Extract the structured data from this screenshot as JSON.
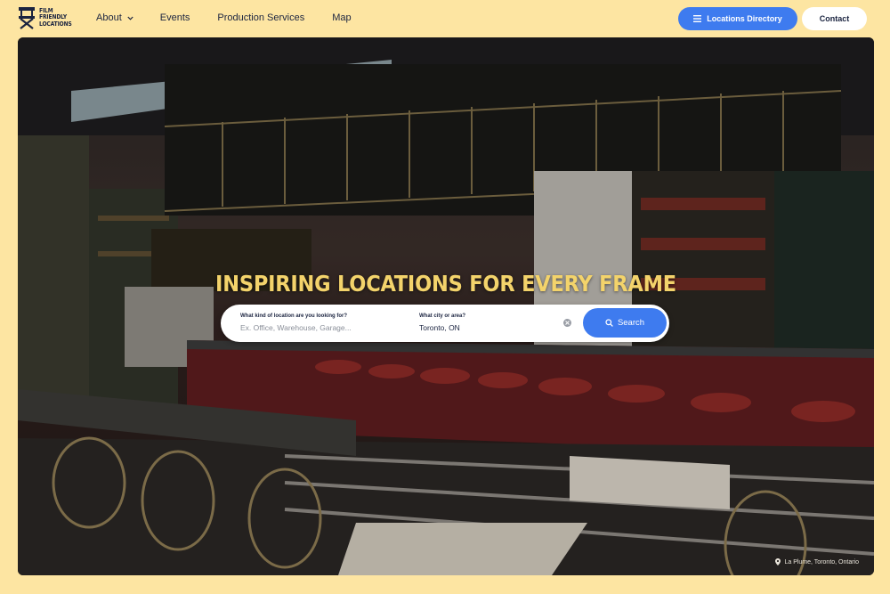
{
  "brand": {
    "logo_lines": [
      "FILM",
      "FRIENDLY",
      "LOCATIONS"
    ],
    "icon": "directors-chair-icon"
  },
  "nav": {
    "items": [
      {
        "label": "About",
        "has_dropdown": true
      },
      {
        "label": "Events"
      },
      {
        "label": "Production Services"
      },
      {
        "label": "Map"
      }
    ],
    "directory_button": {
      "label": "Locations Directory",
      "icon": "menu-icon"
    },
    "contact_button": {
      "label": "Contact"
    }
  },
  "hero": {
    "headline": "INSPIRING LOCATIONS FOR EVERY FRAME",
    "search": {
      "what_label": "What kind of location are you looking for?",
      "what_placeholder": "Ex. Office, Warehouse, Garage...",
      "where_label": "What city or area?",
      "where_value": "Toronto, ON",
      "button_label": "Search",
      "button_icon": "search-icon"
    },
    "photo_credit": "La Plume, Toronto, Ontario",
    "credit_icon": "map-pin-icon"
  },
  "colors": {
    "page_background": "#fde5a2",
    "accent_blue": "#3e7bef",
    "headline_yellow": "#f3d36b",
    "navy_text": "#1b2440"
  }
}
